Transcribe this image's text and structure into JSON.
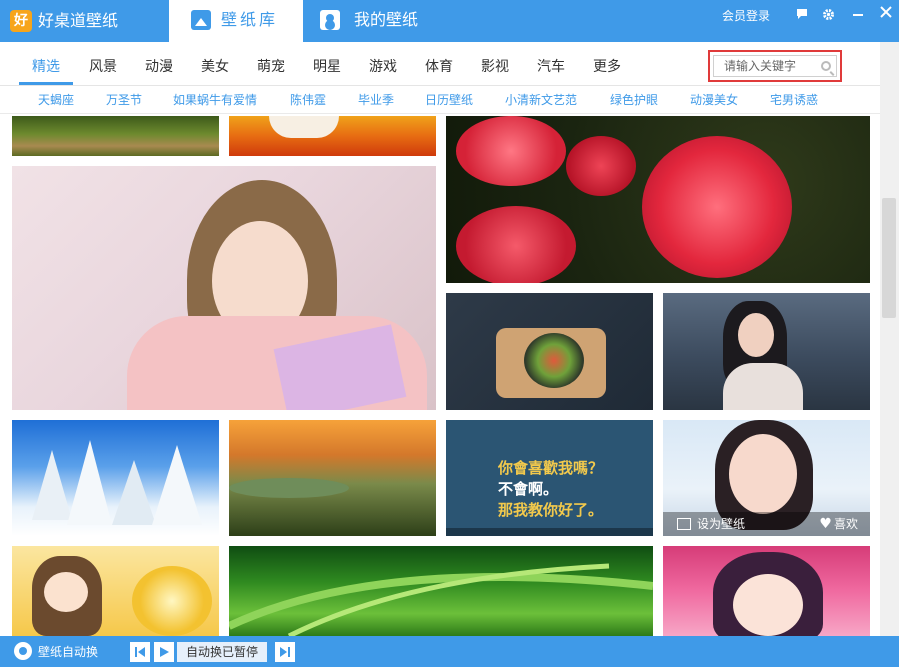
{
  "app": {
    "logo_char": "好",
    "title": "好桌道壁纸"
  },
  "tabs": {
    "library": "壁纸库",
    "mine": "我的壁纸"
  },
  "header": {
    "member_login": "会员登录"
  },
  "icons": {
    "chat": "chat-icon",
    "settings": "gear-icon",
    "minimize": "minimize-icon",
    "close": "close-icon"
  },
  "categories": [
    "精选",
    "风景",
    "动漫",
    "美女",
    "萌宠",
    "明星",
    "游戏",
    "体育",
    "影视",
    "汽车",
    "更多"
  ],
  "search": {
    "placeholder": "请输入关键字"
  },
  "tags": [
    "天蝎座",
    "万圣节",
    "如果蜗牛有爱情",
    "陈伟霆",
    "毕业季",
    "日历壁纸",
    "小清新文艺范",
    "绿色护眼",
    "动漫美女",
    "宅男诱惑"
  ],
  "tiles": {
    "quote": {
      "line1": "你會喜歡我嗎？",
      "line2": "不會啊。",
      "line3": "那我教你好了。"
    },
    "actions": {
      "set_wallpaper": "设为壁纸",
      "like": "喜欢"
    }
  },
  "bottom": {
    "auto_switch": "壁纸自动换",
    "status": "自动换已暂停"
  },
  "colors": {
    "accent": "#3f9ae8",
    "search_border": "#e03a3a"
  }
}
